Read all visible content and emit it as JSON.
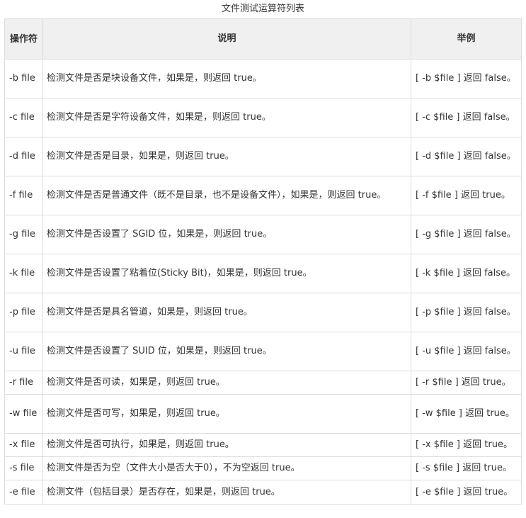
{
  "caption": "文件测试运算符列表",
  "headers": {
    "operator": "操作符",
    "description": "说明",
    "example": "举例"
  },
  "rows": [
    {
      "op": "-b file",
      "desc": "检测文件是否是块设备文件，如果是，则返回 true。",
      "example": "[ -b $file ] 返回 false。"
    },
    {
      "op": "-c file",
      "desc": "检测文件是否是字符设备文件，如果是，则返回 true。",
      "example": "[ -c $file ] 返回 false。"
    },
    {
      "op": "-d file",
      "desc": "检测文件是否是目录，如果是，则返回 true。",
      "example": "[ -d $file ] 返回 false。"
    },
    {
      "op": "-f file",
      "desc": "检测文件是否是普通文件（既不是目录，也不是设备文件），如果是，则返回 true。",
      "example": "[ -f $file ] 返回 true。"
    },
    {
      "op": "-g file",
      "desc": "检测文件是否设置了 SGID 位，如果是，则返回 true。",
      "example": "[ -g $file ] 返回 false。"
    },
    {
      "op": "-k file",
      "desc": "检测文件是否设置了粘着位(Sticky Bit)，如果是，则返回 true。",
      "example": "[ -k $file ] 返回 false。"
    },
    {
      "op": "-p file",
      "desc": "检测文件是否是具名管道，如果是，则返回 true。",
      "example": "[ -p $file ] 返回 false。"
    },
    {
      "op": "-u file",
      "desc": "检测文件是否设置了 SUID 位，如果是，则返回 true。",
      "example": "[ -u $file ] 返回 false。"
    },
    {
      "op": "-r file",
      "desc": "检测文件是否可读，如果是，则返回 true。",
      "example": "[ -r $file ] 返回 true。"
    },
    {
      "op": "-w file",
      "desc": "检测文件是否可写，如果是，则返回 true。",
      "example": "[ -w $file ] 返回 true。"
    },
    {
      "op": "-x file",
      "desc": "检测文件是否可执行，如果是，则返回 true。",
      "example": "[ -x $file ] 返回 true。"
    },
    {
      "op": "-s file",
      "desc": "检测文件是否为空（文件大小是否大于0），不为空返回 true。",
      "example": "[ -s $file ] 返回 true。"
    },
    {
      "op": "-e file",
      "desc": "检测文件（包括目录）是否存在，如果是，则返回 true。",
      "example": "[ -e $file ] 返回 true。"
    }
  ]
}
